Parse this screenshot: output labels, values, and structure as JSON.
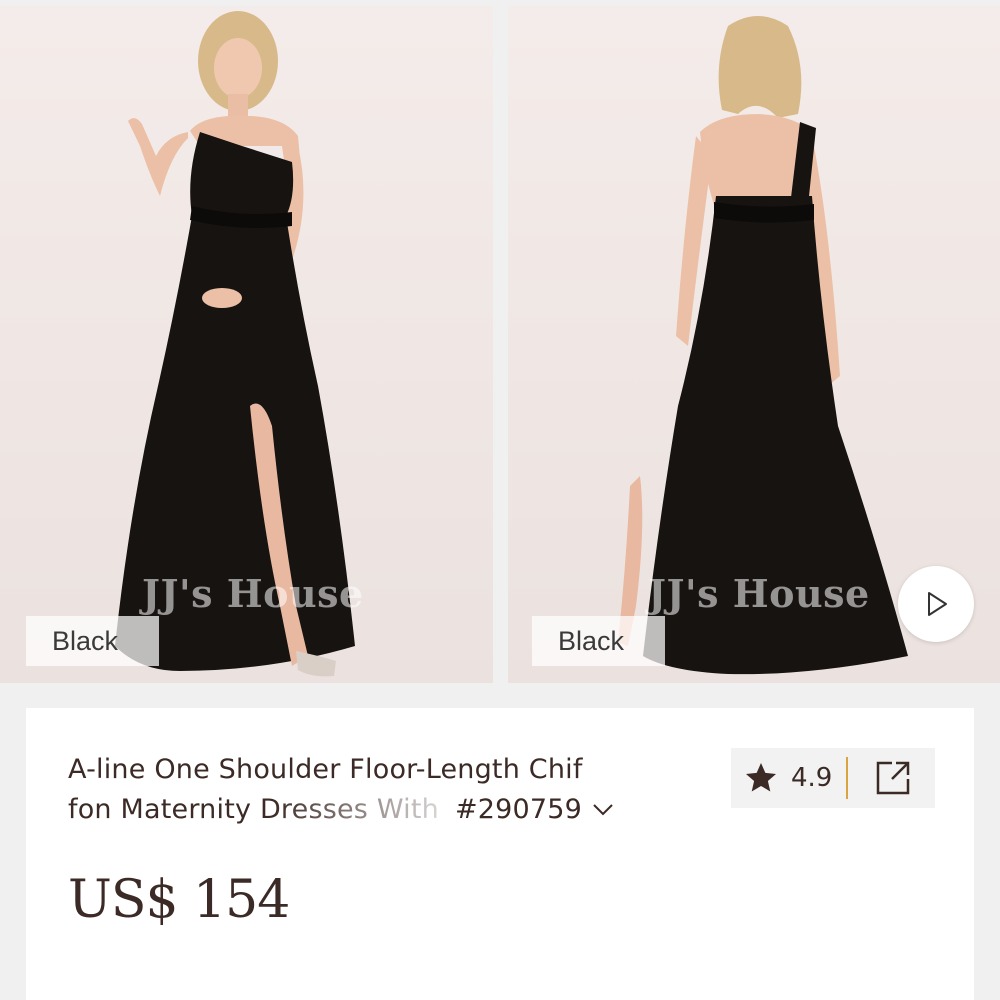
{
  "gallery": {
    "images": [
      {
        "view": "front",
        "color_label": "Black",
        "watermark": "JJ's House"
      },
      {
        "view": "back",
        "color_label": "Black",
        "watermark": "JJ's House"
      }
    ],
    "play_icon": "play-icon"
  },
  "product": {
    "title_line1": "A-line One Shoulder Floor-Length Chif",
    "title_line2": "fon Maternity Dresses With",
    "sku": "#290759",
    "expand_icon": "chevron-down-icon",
    "rating": "4.9",
    "rating_icon": "star-icon",
    "share_icon": "share-external-icon",
    "price": "US$ 154"
  },
  "colors": {
    "text": "#3b2a25",
    "divider_accent": "#d9a441",
    "dress": "#161311"
  }
}
